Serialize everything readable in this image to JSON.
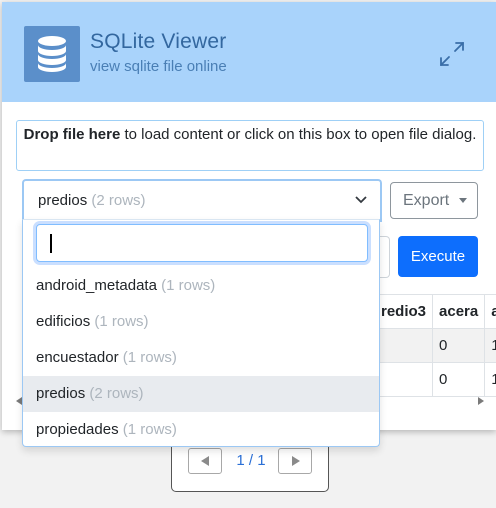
{
  "header": {
    "title": "SQLite Viewer",
    "subtitle": "view sqlite file online",
    "logo_icon": "database-icon",
    "expand_icon": "expand-arrows-icon",
    "background": "#a9d3fb"
  },
  "dropzone": {
    "bold": "Drop file here",
    "text": " to load content or click on this box to open file dialog."
  },
  "table_select": {
    "selected_name": "predios",
    "selected_rows": "(2 rows)",
    "search_value": "",
    "options": [
      {
        "name": "android_metadata",
        "rows": "(1 rows)",
        "active": false
      },
      {
        "name": "edificios",
        "rows": "(1 rows)",
        "active": false
      },
      {
        "name": "encuestador",
        "rows": "(1 rows)",
        "active": false
      },
      {
        "name": "predios",
        "rows": "(2 rows)",
        "active": true
      },
      {
        "name": "propiedades",
        "rows": "(1 rows)",
        "active": false
      }
    ]
  },
  "toolbar": {
    "export_label": "Export",
    "execute_label": "Execute",
    "execute_color": "#0d6efd"
  },
  "grid": {
    "columns": [
      "redio3",
      "acera",
      "a"
    ],
    "rows": [
      [
        "",
        "0",
        "1"
      ],
      [
        "",
        "0",
        "1"
      ]
    ]
  },
  "pager": {
    "text": "1 / 1"
  }
}
